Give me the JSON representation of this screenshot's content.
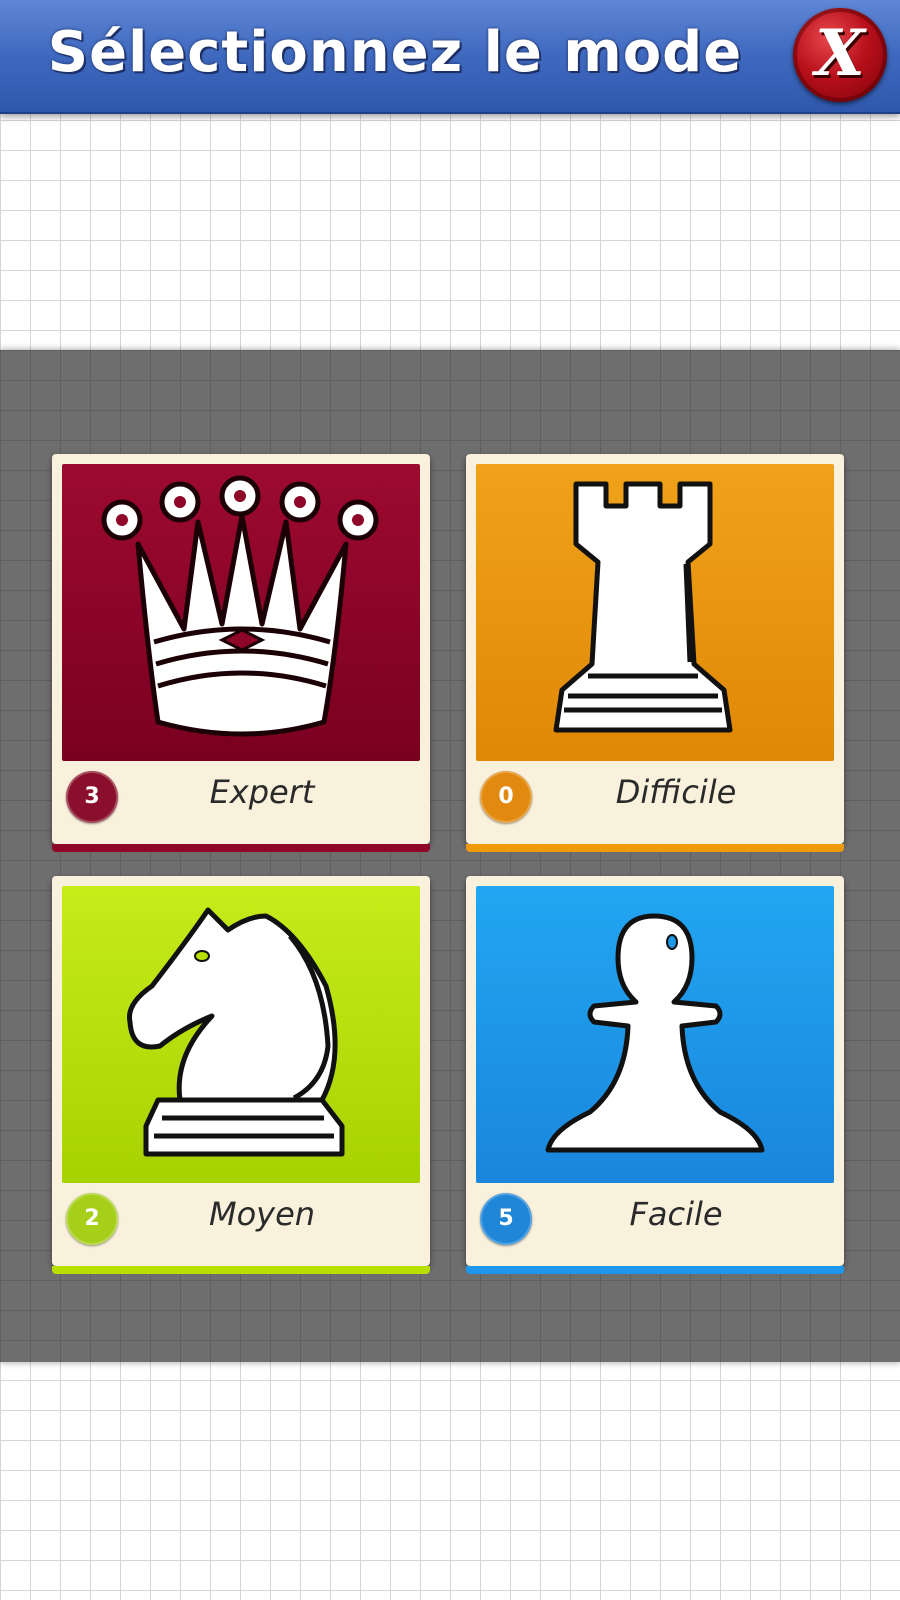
{
  "header": {
    "title": "Sélectionnez le mode",
    "close_label": "X"
  },
  "modes": [
    {
      "label": "Expert",
      "count": "3",
      "piece": "queen",
      "color": "#8e0628",
      "badge_color": "#8a0f2c"
    },
    {
      "label": "Difficile",
      "count": "0",
      "piece": "rook",
      "color": "#ee9a0c",
      "badge_color": "#e28a10"
    },
    {
      "label": "Moyen",
      "count": "2",
      "piece": "knight",
      "color": "#b7e000",
      "badge_color": "#a6cf1a"
    },
    {
      "label": "Facile",
      "count": "5",
      "piece": "pawn",
      "color": "#1e97ea",
      "badge_color": "#1f86d8"
    }
  ]
}
